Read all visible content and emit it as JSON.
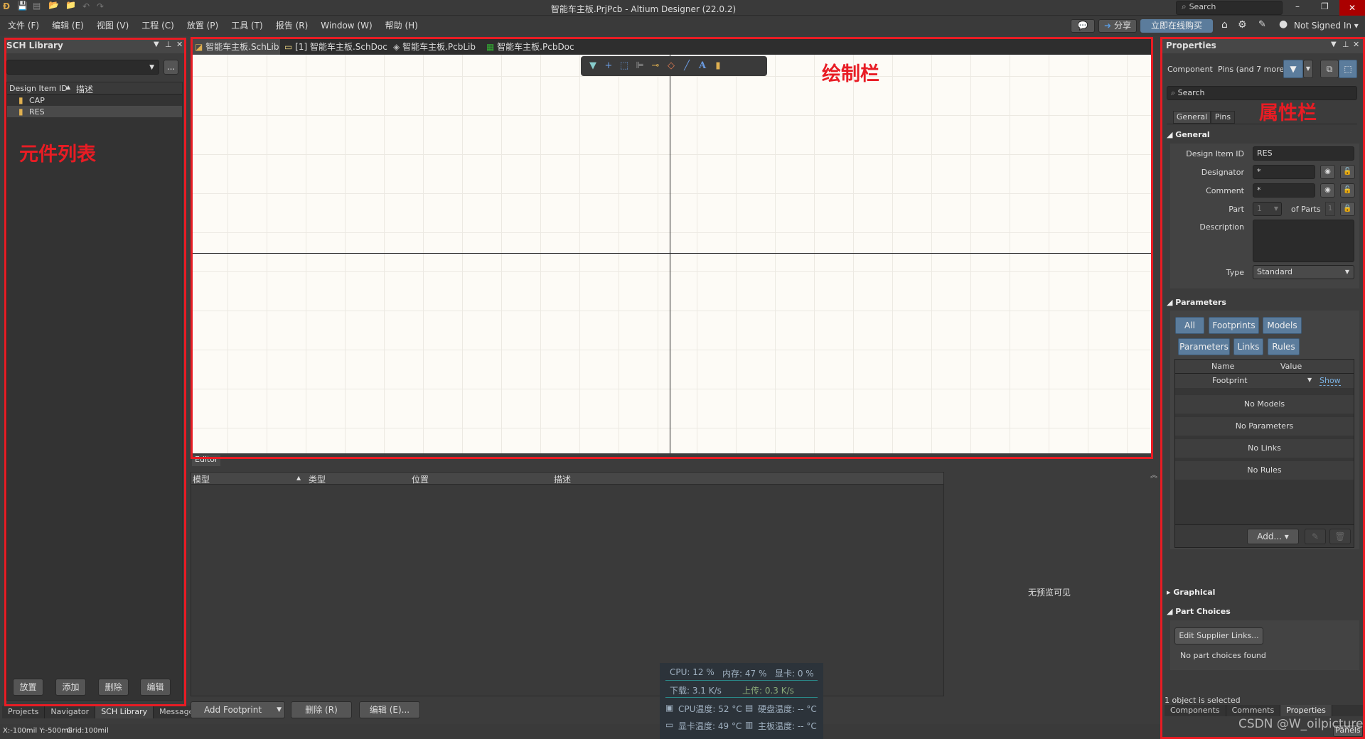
{
  "window": {
    "title": "智能车主板.PrjPcb - Altium Designer (22.0.2)",
    "search_placeholder": "Search"
  },
  "menu": [
    "文件 (F)",
    "编辑 (E)",
    "视图 (V)",
    "工程 (C)",
    "放置 (P)",
    "工具 (T)",
    "报告 (R)",
    "Window (W)",
    "帮助 (H)"
  ],
  "toolbar_right": {
    "share": "分享",
    "buy": "立即在线购买",
    "user": "Not Signed In"
  },
  "sch_library": {
    "title": "SCH Library",
    "col_id": "Design Item ID",
    "col_desc": "描述",
    "items": [
      "CAP",
      "RES"
    ],
    "selected": "RES",
    "buttons": [
      "放置",
      "添加",
      "删除",
      "编辑"
    ],
    "browse": "..."
  },
  "left_tabs": [
    "Projects",
    "Navigator",
    "SCH Library",
    "Messages"
  ],
  "doc_tabs": [
    "智能车主板.SchLib",
    "[1] 智能车主板.SchDoc",
    "智能车主板.PcbLib",
    "智能车主板.PcbDoc"
  ],
  "drawing_toolbar": [
    "filter-icon",
    "crosshair-icon",
    "select-rect-icon",
    "align-icon",
    "pin-icon",
    "eraser-icon",
    "line-icon",
    "text-icon",
    "part-icon"
  ],
  "editor": {
    "tab": "Editor",
    "columns": [
      "模型",
      "类型",
      "位置",
      "描述"
    ],
    "no_preview": "无预览可见",
    "buttons": {
      "add_footprint": "Add Footprint",
      "delete": "删除 (R)",
      "edit": "编辑 (E)..."
    }
  },
  "perf": {
    "cpu": "CPU: 12 %",
    "mem": "内存: 47 %",
    "gpu": "显卡: 0 %",
    "down": "下载: 3.1 K/s",
    "up": "上传: 0.3 K/s",
    "cpu_temp": "CPU温度: 52 °C",
    "disk_temp": "硬盘温度: -- °C",
    "gpu_temp": "显卡温度: 49 °C",
    "board_temp": "主板温度: -- °C"
  },
  "status": {
    "coords": "X:-100mil Y:-500mil",
    "grid": "Grid:100mil"
  },
  "properties": {
    "title": "Properties",
    "component": "Component",
    "filter_text": "Pins (and 7 more)",
    "search": "Search",
    "tabs": [
      "General",
      "Pins"
    ],
    "general": "General",
    "design_item_id_label": "Design Item ID",
    "design_item_id": "RES",
    "designator_label": "Designator",
    "designator": "*",
    "comment_label": "Comment",
    "comment": "*",
    "part_label": "Part",
    "part": "1",
    "of_parts_label": "of Parts",
    "of_parts": "1",
    "description_label": "Description",
    "type_label": "Type",
    "type": "Standard",
    "parameters": "Parameters",
    "param_filters": [
      "All",
      "Footprints",
      "Models",
      "Parameters",
      "Links",
      "Rules"
    ],
    "param_cols": [
      "Name",
      "Value"
    ],
    "footprint_row": {
      "name": "Footprint",
      "value": "Show"
    },
    "empty": [
      "No Models",
      "No Parameters",
      "No Links",
      "No Rules"
    ],
    "add": "Add...",
    "graphical": "Graphical",
    "part_choices": "Part Choices",
    "edit_supplier": "Edit Supplier Links...",
    "no_choices": "No part choices found",
    "selection": "1 object is selected",
    "bottom_tabs": [
      "Components",
      "Comments",
      "Properties"
    ],
    "panels": "Panels"
  },
  "annotations": {
    "left": "元件列表",
    "center": "绘制栏",
    "right": "属性栏",
    "watermark": "CSDN @W_oilpicture"
  },
  "colors": {
    "annotation": "#e81c24",
    "accent": "#5b7c9c",
    "canvas": "#fdfbf6"
  }
}
